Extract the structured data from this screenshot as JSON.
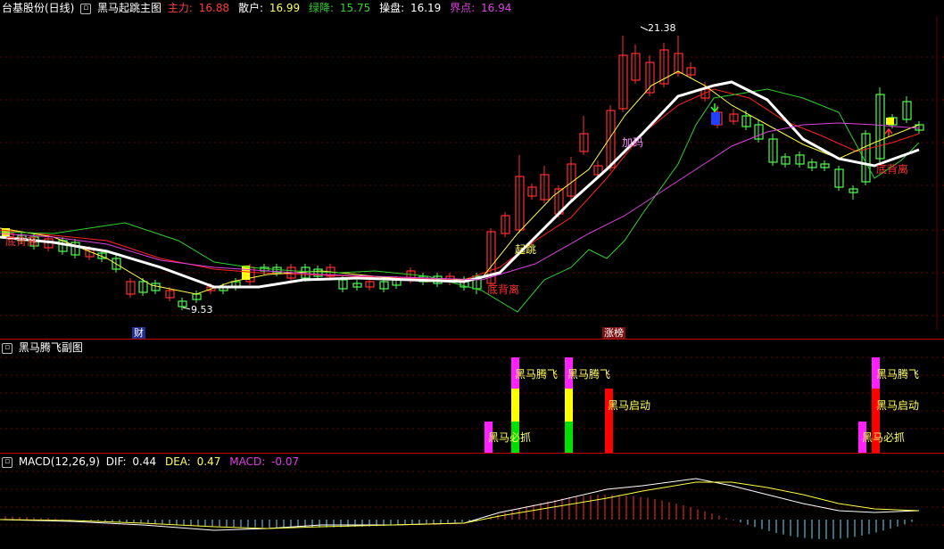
{
  "main": {
    "stock": "台基股份(日线)",
    "indicator": "黑马起跳主图",
    "legend": [
      {
        "label": "主力:",
        "value": "16.88",
        "color": "#ff3b3b"
      },
      {
        "label": "散户:",
        "value": "16.99",
        "color": "#ffff60"
      },
      {
        "label": "绿降:",
        "value": "15.75",
        "color": "#30d030"
      },
      {
        "label": "操盘:",
        "value": "16.19",
        "color": "#ffffff"
      },
      {
        "label": "界点:",
        "value": "16.94",
        "color": "#e040e0"
      }
    ],
    "price_high": "21.38",
    "price_low": "9.53",
    "annotations": {
      "dibeili_1": "底背离",
      "dibeili_2": "底背离",
      "dibeili_3": "底背离",
      "qitiao": "起跳",
      "jiama": "加码"
    },
    "markers": {
      "cai": "财",
      "zhangbang": "涨榜"
    }
  },
  "sub1": {
    "title": "黑马腾飞副图",
    "labels": {
      "tengfei_1": "黑马腾飞",
      "tengfei_2": "黑马腾飞",
      "tengfei_3": "黑马腾飞",
      "qidong_1": "黑马启动",
      "qidong_2": "黑马启动",
      "bizhua_1": "黑马必抓",
      "bizhua_2": "黑马必抓"
    }
  },
  "macd": {
    "title": "MACD(12,26,9)",
    "legend": [
      {
        "label": "DIF:",
        "value": "0.44",
        "color": "#ffffff"
      },
      {
        "label": "DEA:",
        "value": "0.47",
        "color": "#ffff60"
      },
      {
        "label": "MACD:",
        "value": "-0.07",
        "color": "#e040e0"
      }
    ]
  },
  "colors": {
    "up": "#ff3030",
    "down": "#50ff50",
    "grid": "#6a0000",
    "separator": "#c00000",
    "magenta": "#ff20ff",
    "yellow": "#ffff00",
    "green": "#00e000",
    "red": "#ff0000",
    "cyan": "#60e0ff"
  }
}
